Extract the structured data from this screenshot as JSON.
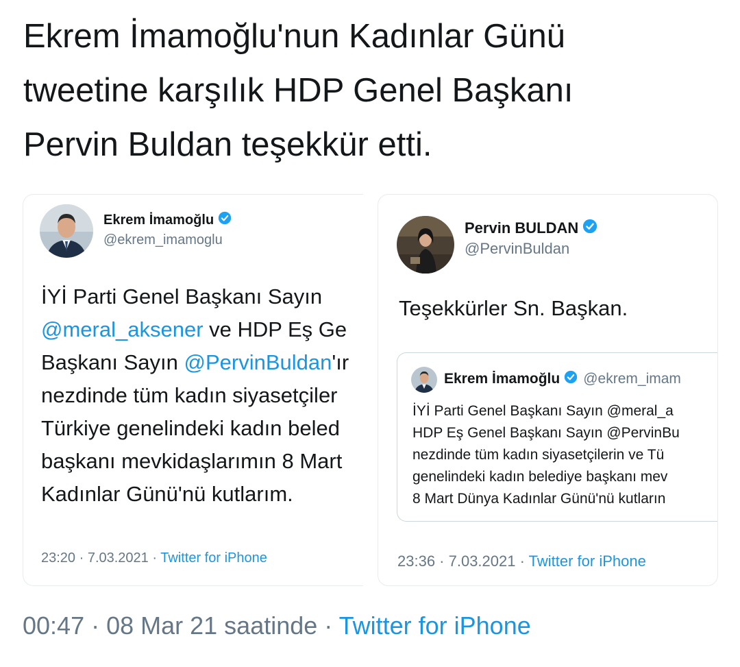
{
  "headline": {
    "line1": "Ekrem İmamoğlu'nun Kadınlar Günü",
    "line2": "tweetine karşılık HDP Genel Başkanı",
    "line3": "Pervin Buldan teşekkür etti."
  },
  "left_tweet": {
    "name": "Ekrem İmamoğlu",
    "handle": "@ekrem_imamoglu",
    "lines": [
      {
        "pre": "İYİ Parti Genel Başkanı Sayın",
        "mention": "",
        "post": ""
      },
      {
        "pre": "",
        "mention": "@meral_aksener",
        "post": " ve HDP Eş Ge"
      },
      {
        "pre": "Başkanı Sayın ",
        "mention": "@PervinBuldan",
        "post": "'ır"
      },
      {
        "pre": "nezdinde tüm kadın siyasetçiler",
        "mention": "",
        "post": ""
      },
      {
        "pre": "Türkiye genelindeki kadın beled",
        "mention": "",
        "post": ""
      },
      {
        "pre": "başkanı mevkidaşlarımın 8 Mart",
        "mention": "",
        "post": ""
      },
      {
        "pre": "Kadınlar Günü'nü kutlarım.",
        "mention": "",
        "post": ""
      }
    ],
    "timestamp": "23:20 · 7.03.2021 · ",
    "source": "Twitter for iPhone"
  },
  "right_tweet": {
    "name": "Pervin BULDAN",
    "handle": "@PervinBuldan",
    "text": "Teşekkürler Sn. Başkan.",
    "quoted": {
      "name": "Ekrem İmamoğlu",
      "handle": "@ekrem_imam",
      "lines": [
        "İYİ Parti Genel Başkanı Sayın @meral_a",
        "HDP Eş Genel Başkanı Sayın @PervinBu",
        "nezdinde tüm kadın siyasetçilerin ve Tü",
        "genelindeki kadın belediye başkanı mev",
        "8 Mart Dünya Kadınlar Günü'nü kutların"
      ]
    },
    "timestamp": "23:36 · 7.03.2021 · ",
    "source": "Twitter for iPhone"
  },
  "bottom": {
    "meta": "00:47 · 08 Mar 21 saatinde · ",
    "source": "Twitter for iPhone"
  },
  "colors": {
    "link": "#1b95e0",
    "muted": "#657786",
    "text": "#14171a",
    "verified": "#1da1f2"
  }
}
